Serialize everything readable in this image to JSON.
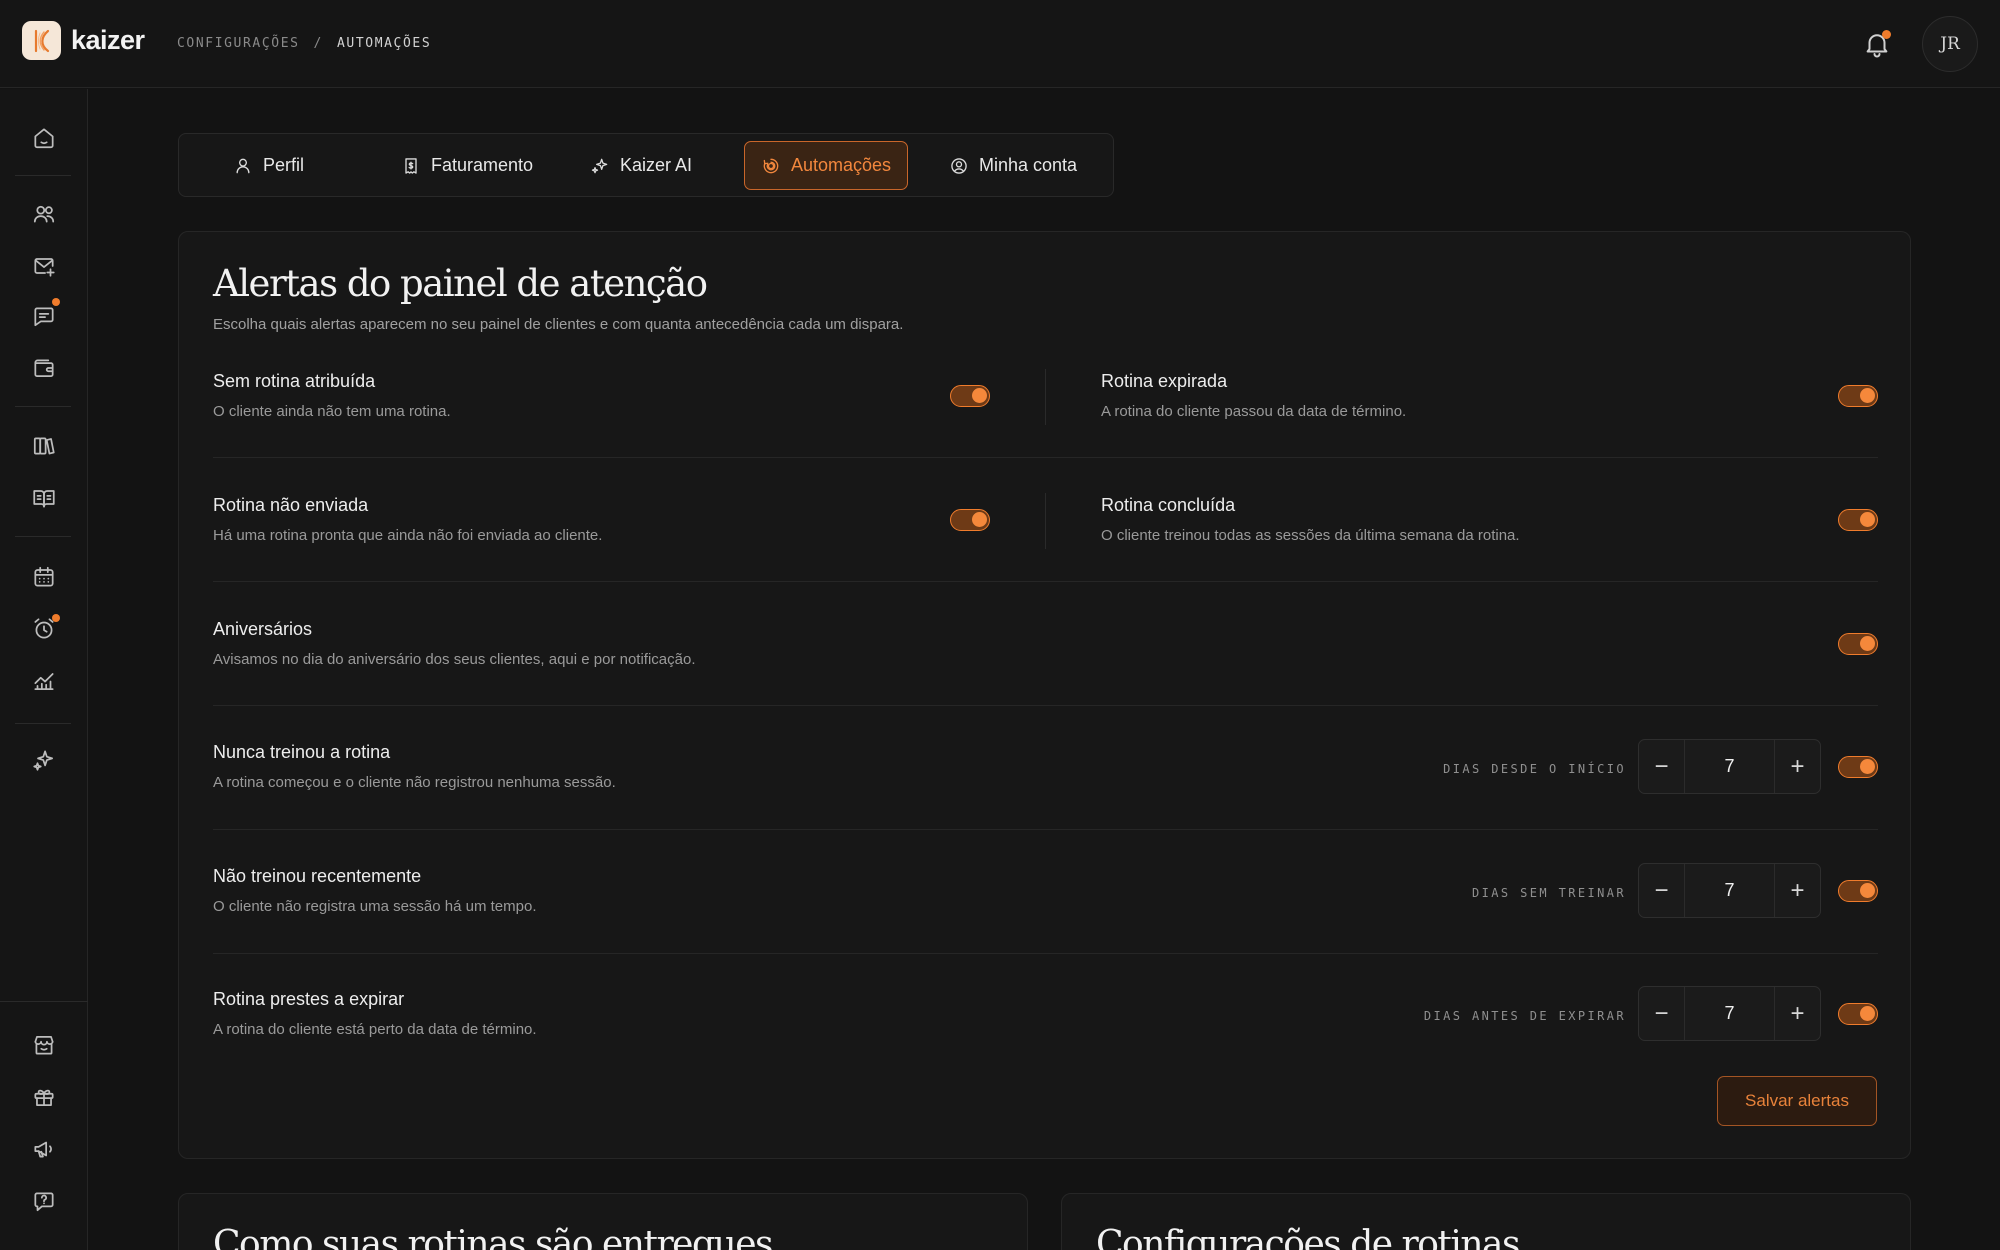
{
  "brand": {
    "name": "kaizer"
  },
  "breadcrumb": {
    "items": [
      "CONFIGURAÇÕES",
      "AUTOMAÇÕES"
    ],
    "separator": "/"
  },
  "user": {
    "initials": "JR"
  },
  "colors": {
    "accent": "#f07c2c",
    "background": "#131313",
    "card": "#171717"
  },
  "sidebar": {
    "icons": [
      "home-icon",
      "users-icon",
      "mail-plus-icon",
      "chat-icon",
      "wallet-icon",
      "books-icon",
      "open-book-icon",
      "calendar-icon",
      "alarm-icon",
      "chart-icon",
      "sparkles-icon",
      "store-icon",
      "gift-icon",
      "megaphone-icon",
      "help-icon"
    ]
  },
  "tabs": [
    {
      "label": "Perfil",
      "icon": "user-icon",
      "active": false
    },
    {
      "label": "Faturamento",
      "icon": "invoice-icon",
      "active": false
    },
    {
      "label": "Kaizer AI",
      "icon": "sparkles-icon",
      "active": false
    },
    {
      "label": "Automações",
      "icon": "automation-icon",
      "active": true
    },
    {
      "label": "Minha conta",
      "icon": "account-circle-icon",
      "active": false
    }
  ],
  "alerts": {
    "title": "Alertas do painel de atenção",
    "subtitle": "Escolha quais alertas aparecem no seu painel de clientes e com quanta antecedência cada um dispara.",
    "paired": [
      {
        "title": "Sem rotina atribuída",
        "desc": "O cliente ainda não tem uma rotina.",
        "enabled": true
      },
      {
        "title": "Rotina expirada",
        "desc": "A rotina do cliente passou da data de término.",
        "enabled": true
      },
      {
        "title": "Rotina não enviada",
        "desc": "Há uma rotina pronta que ainda não foi enviada ao cliente.",
        "enabled": true
      },
      {
        "title": "Rotina concluída",
        "desc": "O cliente treinou todas as sessões da última semana da rotina.",
        "enabled": true
      }
    ],
    "birthday": {
      "title": "Aniversários",
      "desc": "Avisamos no dia do aniversário dos seus clientes, aqui e por notificação.",
      "enabled": true
    },
    "threshold": [
      {
        "title": "Nunca treinou a rotina",
        "desc": "A rotina começou e o cliente não registrou nenhuma sessão.",
        "label": "DIAS DESDE O INÍCIO",
        "value": "7",
        "enabled": true
      },
      {
        "title": "Não treinou recentemente",
        "desc": "O cliente não registra uma sessão há um tempo.",
        "label": "DIAS SEM TREINAR",
        "value": "7",
        "enabled": true
      },
      {
        "title": "Rotina prestes a expirar",
        "desc": "A rotina do cliente está perto da data de término.",
        "label": "DIAS ANTES DE EXPIRAR",
        "value": "7",
        "enabled": true
      }
    ],
    "save_label": "Salvar alertas"
  },
  "bottom_cards": [
    {
      "title": "Como suas rotinas são entregues"
    },
    {
      "title": "Configurações de rotinas"
    }
  ]
}
